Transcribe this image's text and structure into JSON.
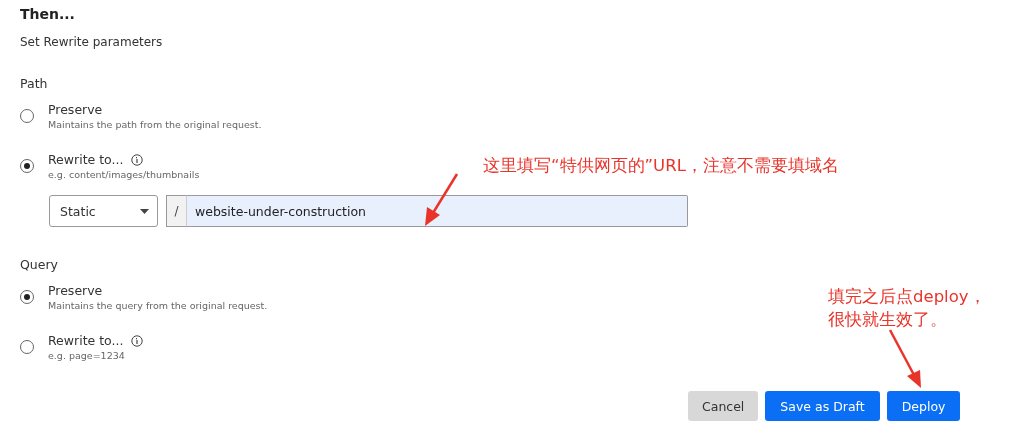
{
  "heading": "Then...",
  "subtitle": "Set Rewrite parameters",
  "sections": [
    {
      "label": "Path",
      "options": [
        {
          "label": "Preserve",
          "hint": "Maintains the path from the original request.",
          "selected": false,
          "info": false
        },
        {
          "label": "Rewrite to...",
          "hint": "e.g. content/images/thumbnails",
          "selected": true,
          "info": true
        }
      ],
      "rewrite": {
        "mode": "Static",
        "prefix": "/",
        "value": "website-under-construction"
      }
    },
    {
      "label": "Query",
      "options": [
        {
          "label": "Preserve",
          "hint": "Maintains the query from the original request.",
          "selected": true,
          "info": false
        },
        {
          "label": "Rewrite to...",
          "hint": "e.g. page=1234",
          "selected": false,
          "info": true
        }
      ]
    }
  ],
  "buttons": [
    {
      "label": "Cancel",
      "kind": "secondary"
    },
    {
      "label": "Save as Draft",
      "kind": "primary"
    },
    {
      "label": "Deploy",
      "kind": "primary"
    }
  ],
  "annotations": [
    {
      "lines": [
        "这里填写“特供网页的”URL，注意不需要填域名"
      ]
    },
    {
      "lines": [
        "填完之后点deploy，",
        "很快就生效了。"
      ]
    }
  ]
}
